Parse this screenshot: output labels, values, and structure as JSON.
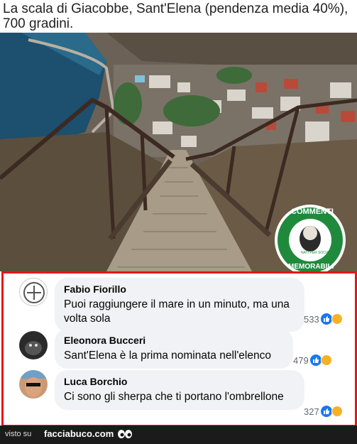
{
  "caption": "La scala di Giacobbe, Sant'Elena (pendenza media 40%), 700 gradini.",
  "badge": {
    "top_text": "COMMENTI",
    "bottom_text": "MEMORABILI",
    "small_text": "NATI PER SOCIAL"
  },
  "comments": [
    {
      "name": "Fabio Fiorillo",
      "text": "Puoi raggiungere il mare in un minuto, ma una volta sola",
      "count": "533"
    },
    {
      "name": "Eleonora Bucceri",
      "text": "Sant'Elena è la prima nominata nell'elenco",
      "count": "479"
    },
    {
      "name": "Luca Borchio",
      "text": "Ci sono gli sherpa che ti portano l'ombrellone",
      "count": "327"
    }
  ],
  "footer": {
    "visto": "visto su",
    "brand": "facciabuco.com"
  },
  "colors": {
    "frame": "#e3161d",
    "badge_green": "#1f8a3c",
    "like_blue": "#1877f2",
    "haha_yellow": "#f7b125"
  },
  "icons": [
    "like-icon",
    "haha-icon",
    "eyes-logo-icon"
  ]
}
